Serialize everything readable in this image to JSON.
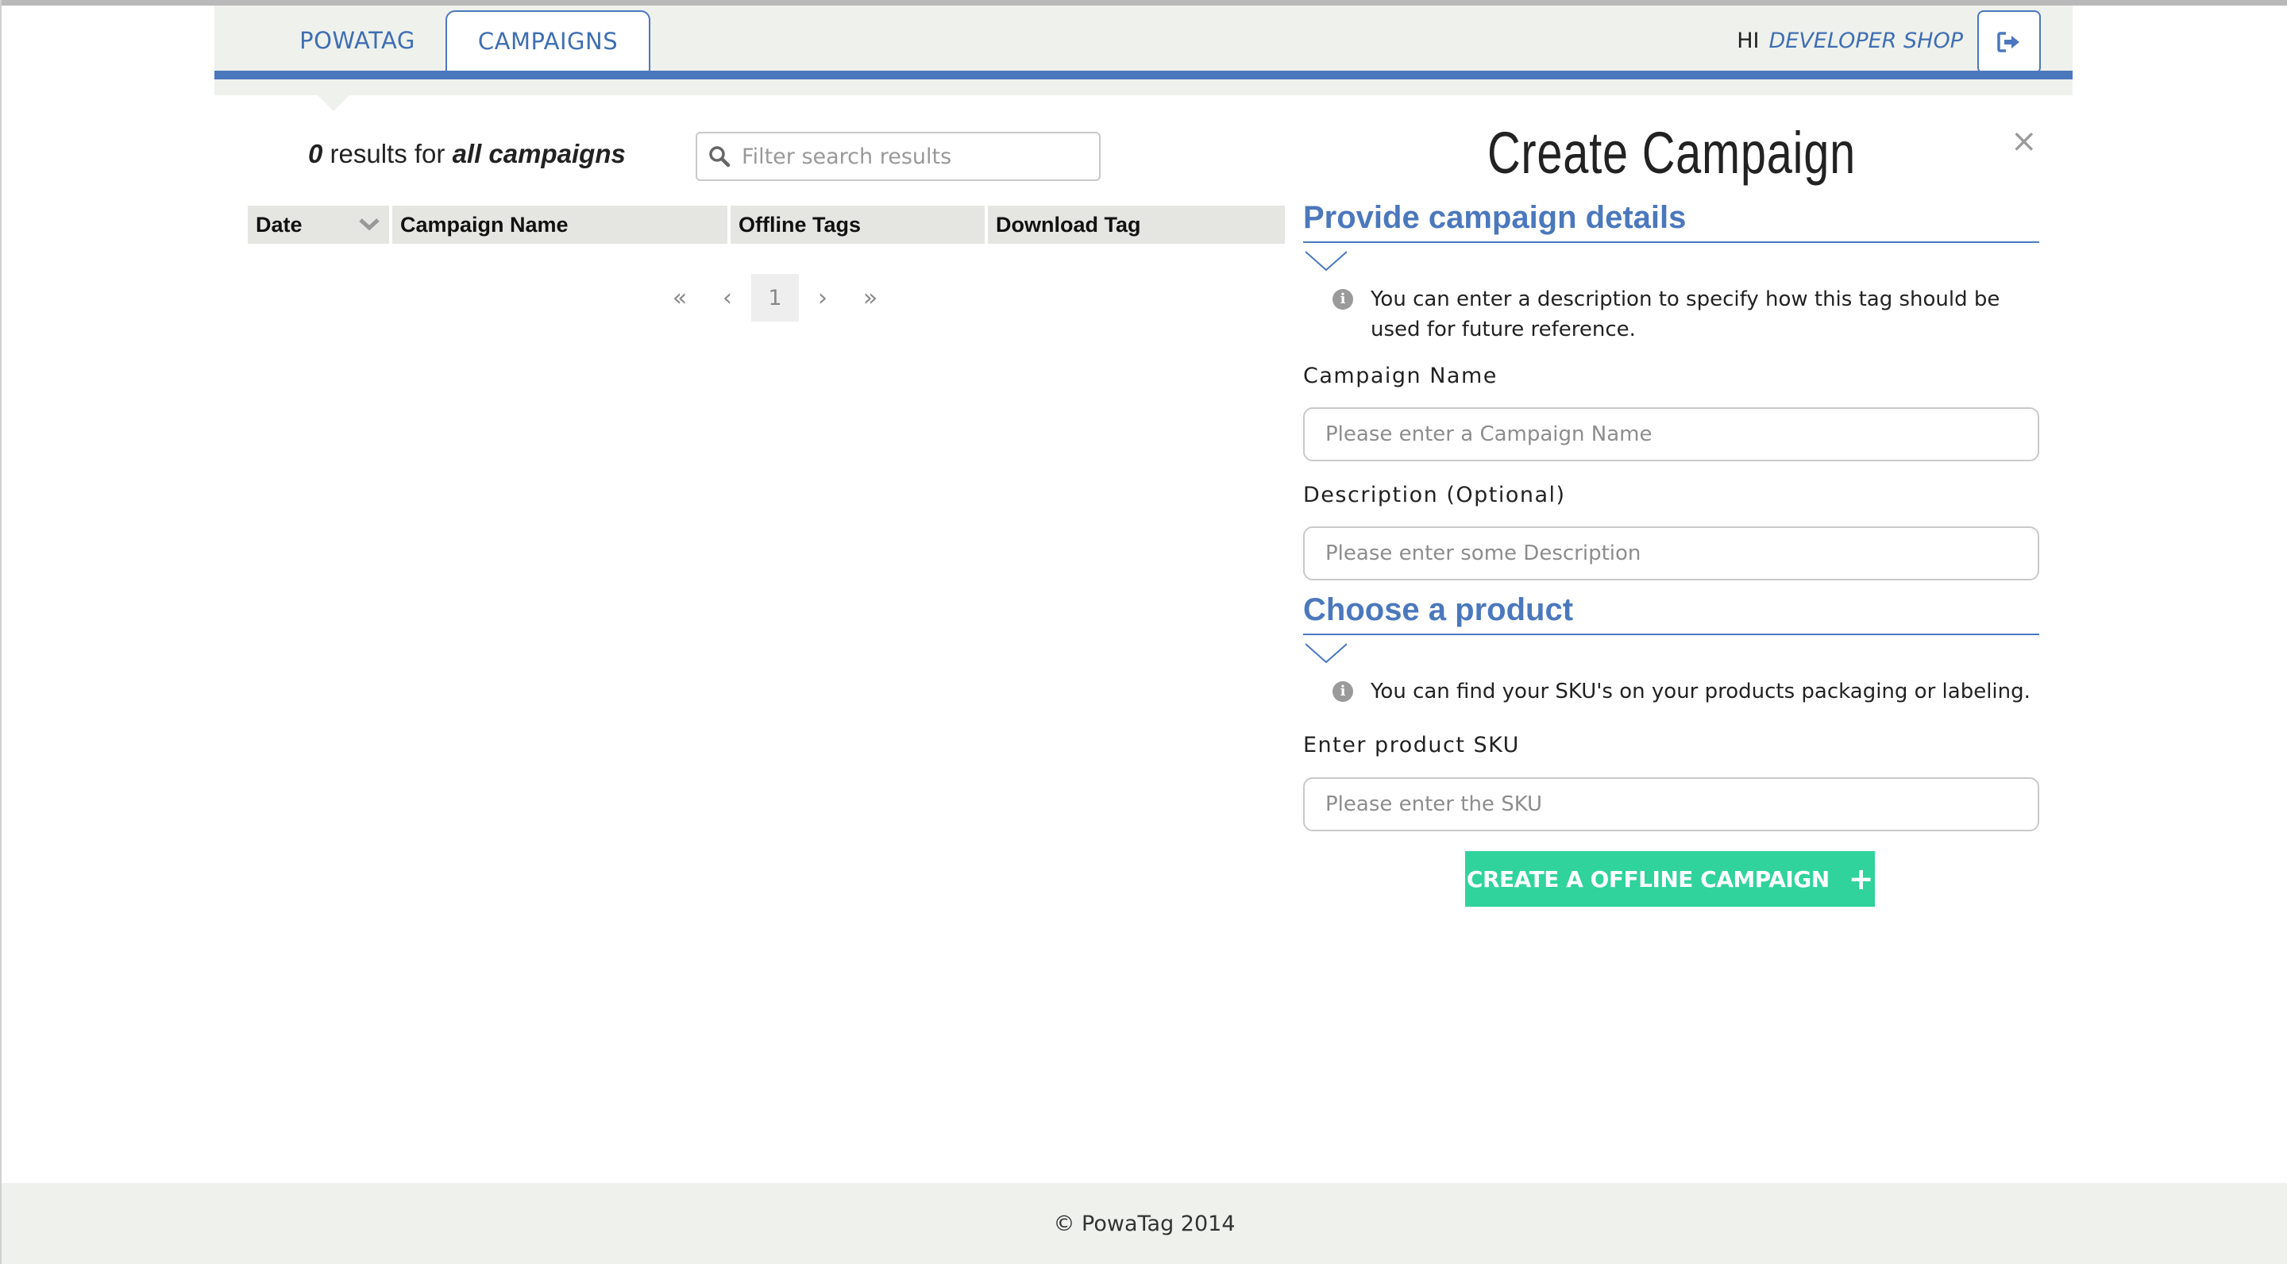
{
  "header": {
    "tabs": [
      {
        "label": "POWATAG",
        "active": false
      },
      {
        "label": "CAMPAIGNS",
        "active": true
      }
    ],
    "greeting": "HI",
    "user_name": "DEVELOPER SHOP",
    "logout_icon": "sign-out-icon",
    "accent_color": "#4b78bd"
  },
  "list": {
    "result_count": "0",
    "results_text": " results for ",
    "results_scope": "all campaigns",
    "search": {
      "placeholder": "Filter search results",
      "value": ""
    },
    "columns": [
      {
        "label": "Date",
        "sortable": true
      },
      {
        "label": "Campaign Name"
      },
      {
        "label": "Offline Tags"
      },
      {
        "label": "Download Tag"
      }
    ],
    "rows": [],
    "pagination": {
      "first": "«",
      "prev": "‹",
      "current": "1",
      "next": "›",
      "last": "»"
    }
  },
  "panel": {
    "title": "Create Campaign",
    "close": "×",
    "details_section": {
      "heading": "Provide campaign details",
      "info": "You can enter a description to specify how this tag should be used for future reference."
    },
    "campaign_name": {
      "label": "Campaign Name",
      "placeholder": "Please enter a Campaign Name",
      "value": ""
    },
    "description": {
      "label": "Description (Optional)",
      "placeholder": "Please enter some Description",
      "value": ""
    },
    "product_section": {
      "heading": "Choose a product",
      "info": "You can find your SKU's on your products packaging or labeling."
    },
    "sku": {
      "label": "Enter product SKU",
      "placeholder": "Please enter the SKU",
      "value": ""
    },
    "submit_label": "CREATE A OFFLINE CAMPAIGN",
    "submit_icon": "plus-icon",
    "submit_color": "#2fd39b"
  },
  "footer": {
    "copyright": "© PowaTag 2014"
  }
}
